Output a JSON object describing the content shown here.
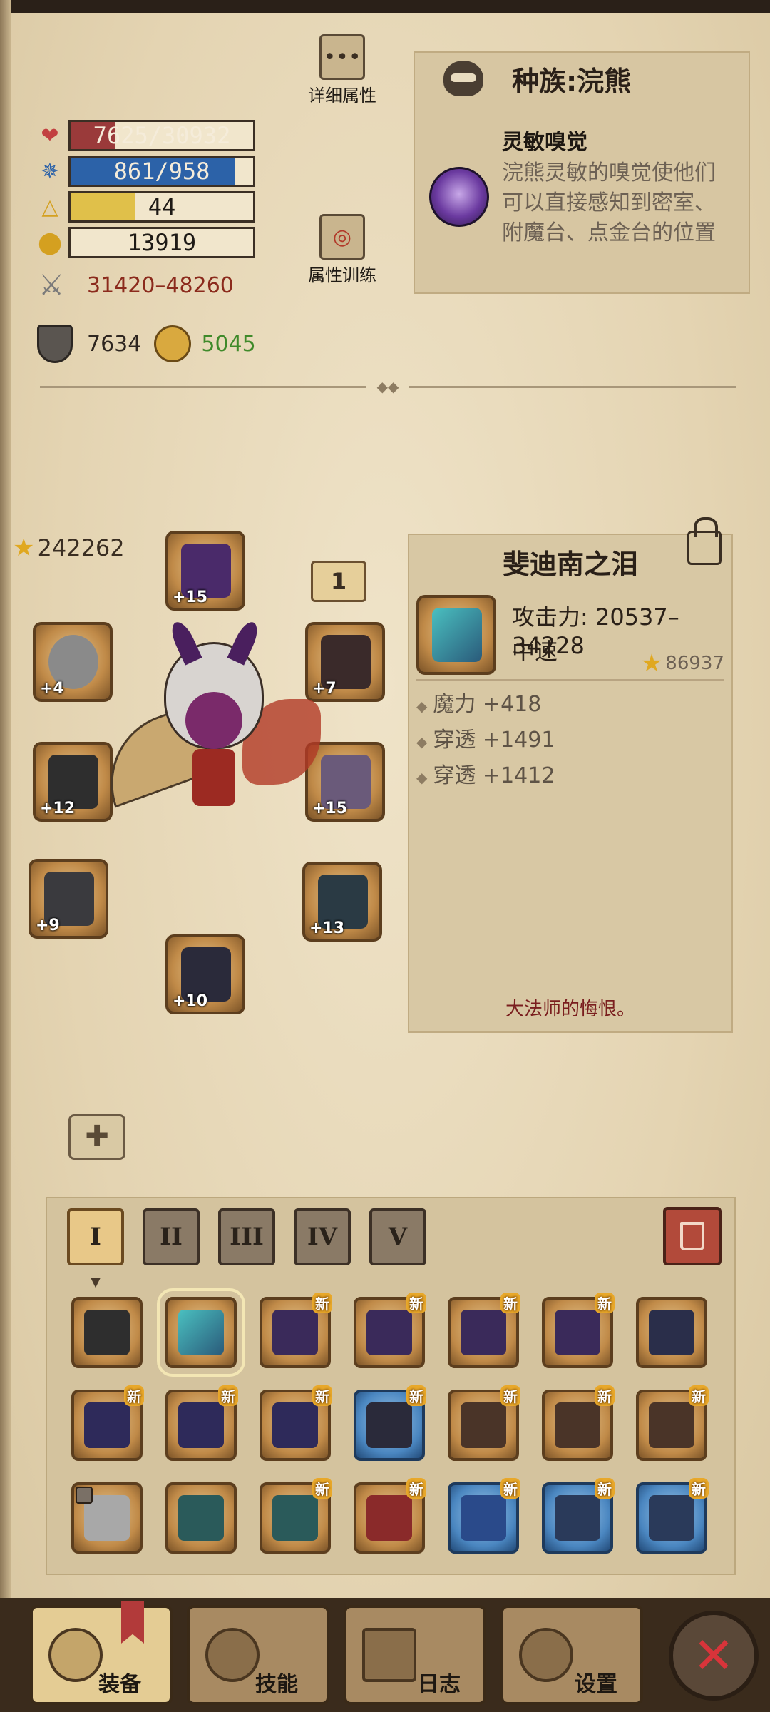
{
  "stats": {
    "hp": {
      "text": "7625/30932",
      "fraction": 0.2465,
      "color": "#9a3a3a"
    },
    "mp": {
      "text": "861/958",
      "fraction": 0.8987,
      "color": "#2c62a8"
    },
    "level": {
      "text": "44",
      "fraction": 0.35,
      "color": "#e0c04a"
    },
    "gold": {
      "text": "13919"
    },
    "attack": "31420–48260",
    "defense": "7634",
    "penetration": "5045"
  },
  "buttons": {
    "detail_attributes": "详细属性",
    "attribute_training": "属性训练"
  },
  "race": {
    "title": "种族:浣熊",
    "trait_name": "灵敏嗅觉",
    "trait_desc": "浣熊灵敏的嗅觉使他们可以直接感知到密室、附魔台、点金台的位置"
  },
  "equipment": {
    "total_score": "242262",
    "tag": "1",
    "slots": [
      {
        "level": "+15",
        "item": "helmet"
      },
      {
        "level": "+4",
        "item": "shield"
      },
      {
        "level": "+7",
        "item": "bat-wings"
      },
      {
        "level": "+12",
        "item": "gauntlet"
      },
      {
        "level": "+15",
        "item": "horned-armor"
      },
      {
        "level": "+9",
        "item": "bracer"
      },
      {
        "level": "+13",
        "item": "plate-armor"
      },
      {
        "level": "+10",
        "item": "leg-armor"
      }
    ]
  },
  "item": {
    "name": "斐迪南之泪",
    "attack": "攻击力: 20537–34228",
    "speed": "中速",
    "score": "86937",
    "attributes": [
      "魔力 +418",
      "穿透 +1491",
      "穿透 +1412"
    ],
    "lore": "大法师的悔恨。"
  },
  "inventory": {
    "tabs": [
      "I",
      "II",
      "III",
      "IV",
      "V"
    ],
    "new_label": "新"
  },
  "nav": {
    "equipment": "装备",
    "skills": "技能",
    "log": "日志",
    "settings": "设置"
  },
  "icons": {
    "hp": "heart-icon",
    "mp": "mana-icon",
    "level": "level-triangle-icon",
    "gold": "gold-coins-icon",
    "attack": "crossed-swords-icon",
    "defense": "shield-icon",
    "penetration": "penetration-icon"
  }
}
